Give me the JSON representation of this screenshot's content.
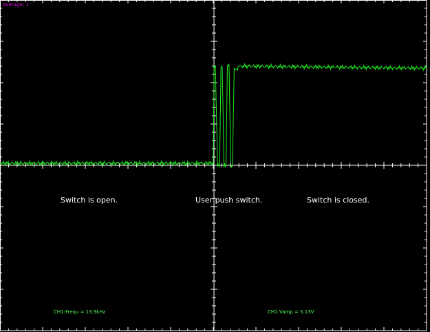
{
  "header": {
    "average_label": "Average: 1"
  },
  "annotations": {
    "open": "Switch is open.",
    "push": "User push switch.",
    "closed": "Switch is closed."
  },
  "measurements": {
    "frequency": "CH1:Frequ = 13.9kHz",
    "amplitude": "CH1:Vamp = 5.13V"
  },
  "colors": {
    "background": "#000000",
    "grid": "#ffffff",
    "trace": "#22ee22",
    "average_label": "#e000e0",
    "measurement_text": "#55ff55"
  },
  "chart_data": {
    "type": "line",
    "grid": true,
    "divisions": {
      "x": 10,
      "y": 8
    },
    "ylim": [
      -4,
      4
    ],
    "series": [
      {
        "x": [
          0,
          5.0,
          5.02,
          5.05,
          5.1,
          5.15,
          5.18,
          5.21,
          5.25,
          5.3,
          5.33,
          5.37,
          5.41,
          5.45,
          5.49,
          5.55,
          5.6,
          10
        ],
        "y": [
          0.05,
          0.05,
          2.4,
          2.4,
          0.0,
          0.0,
          2.4,
          2.4,
          0.0,
          0.0,
          2.4,
          2.4,
          0.0,
          0.0,
          2.35,
          2.3,
          2.4,
          2.35
        ]
      }
    ]
  }
}
